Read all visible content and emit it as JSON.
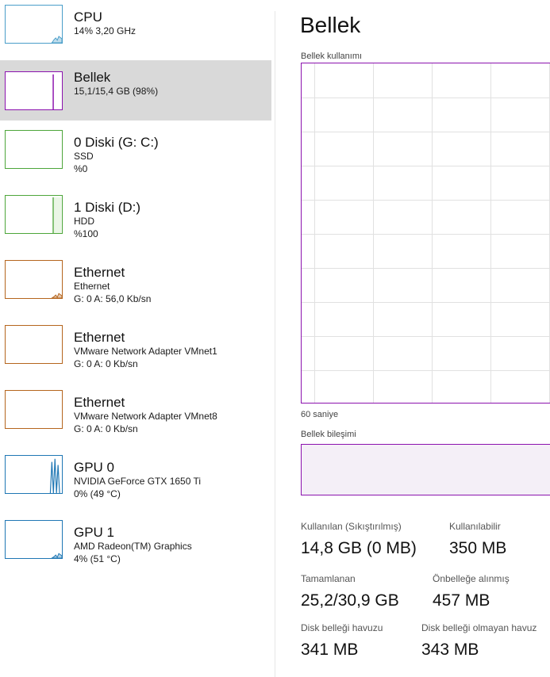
{
  "colors": {
    "cpu": "#4a9ec9",
    "memory": "#8b12ae",
    "disk": "#4da63a",
    "ethernet": "#b5651d",
    "gpu": "#1f77b4",
    "selected_bg": "#d9d9d9"
  },
  "sidebar": {
    "items": [
      {
        "name": "CPU",
        "lines": [
          "14% 3,20 GHz"
        ],
        "color_key": "cpu",
        "usage": 0.14
      },
      {
        "name": "Bellek",
        "lines": [
          "15,1/15,4 GB (98%)"
        ],
        "color_key": "memory",
        "usage": 0.98
      },
      {
        "name": "0 Diski (G: C:)",
        "lines": [
          "SSD",
          "%0"
        ],
        "color_key": "disk",
        "usage": 0.0
      },
      {
        "name": "1 Diski (D:)",
        "lines": [
          "HDD",
          "%100"
        ],
        "color_key": "disk",
        "usage": 1.0
      },
      {
        "name": "Ethernet",
        "lines": [
          "Ethernet",
          "G: 0 A: 56,0 Kb/sn"
        ],
        "color_key": "ethernet",
        "usage": 0.1
      },
      {
        "name": "Ethernet",
        "lines": [
          "VMware Network Adapter VMnet1",
          "G: 0 A: 0 Kb/sn"
        ],
        "color_key": "ethernet",
        "usage": 0.0
      },
      {
        "name": "Ethernet",
        "lines": [
          "VMware Network Adapter VMnet8",
          "G: 0 A: 0 Kb/sn"
        ],
        "color_key": "ethernet",
        "usage": 0.0
      },
      {
        "name": "GPU 0",
        "lines": [
          "NVIDIA GeForce GTX 1650 Ti",
          "0% (49 °C)"
        ],
        "color_key": "gpu",
        "usage": 0.0
      },
      {
        "name": "GPU 1",
        "lines": [
          "AMD Radeon(TM) Graphics",
          "4% (51 °C)"
        ],
        "color_key": "gpu",
        "usage": 0.04
      }
    ]
  },
  "main": {
    "title": "Bellek",
    "usage_graph_label": "Bellek kullanımı",
    "time_label": "60 saniye",
    "composition_label": "Bellek bileşimi",
    "stats": [
      {
        "label": "Kullanılan (Sıkıştırılmış)",
        "value": "14,8 GB (0 MB)"
      },
      {
        "label": "Kullanılabilir",
        "value": "350 MB"
      },
      {
        "label": "Tamamlanan",
        "value": "25,2/30,9 GB"
      },
      {
        "label": "Önbelleğe alınmış",
        "value": "457 MB"
      },
      {
        "label": "Disk belleği havuzu",
        "value": "341 MB"
      },
      {
        "label": "Disk belleği olmayan havuz",
        "value": "343 MB"
      }
    ]
  }
}
